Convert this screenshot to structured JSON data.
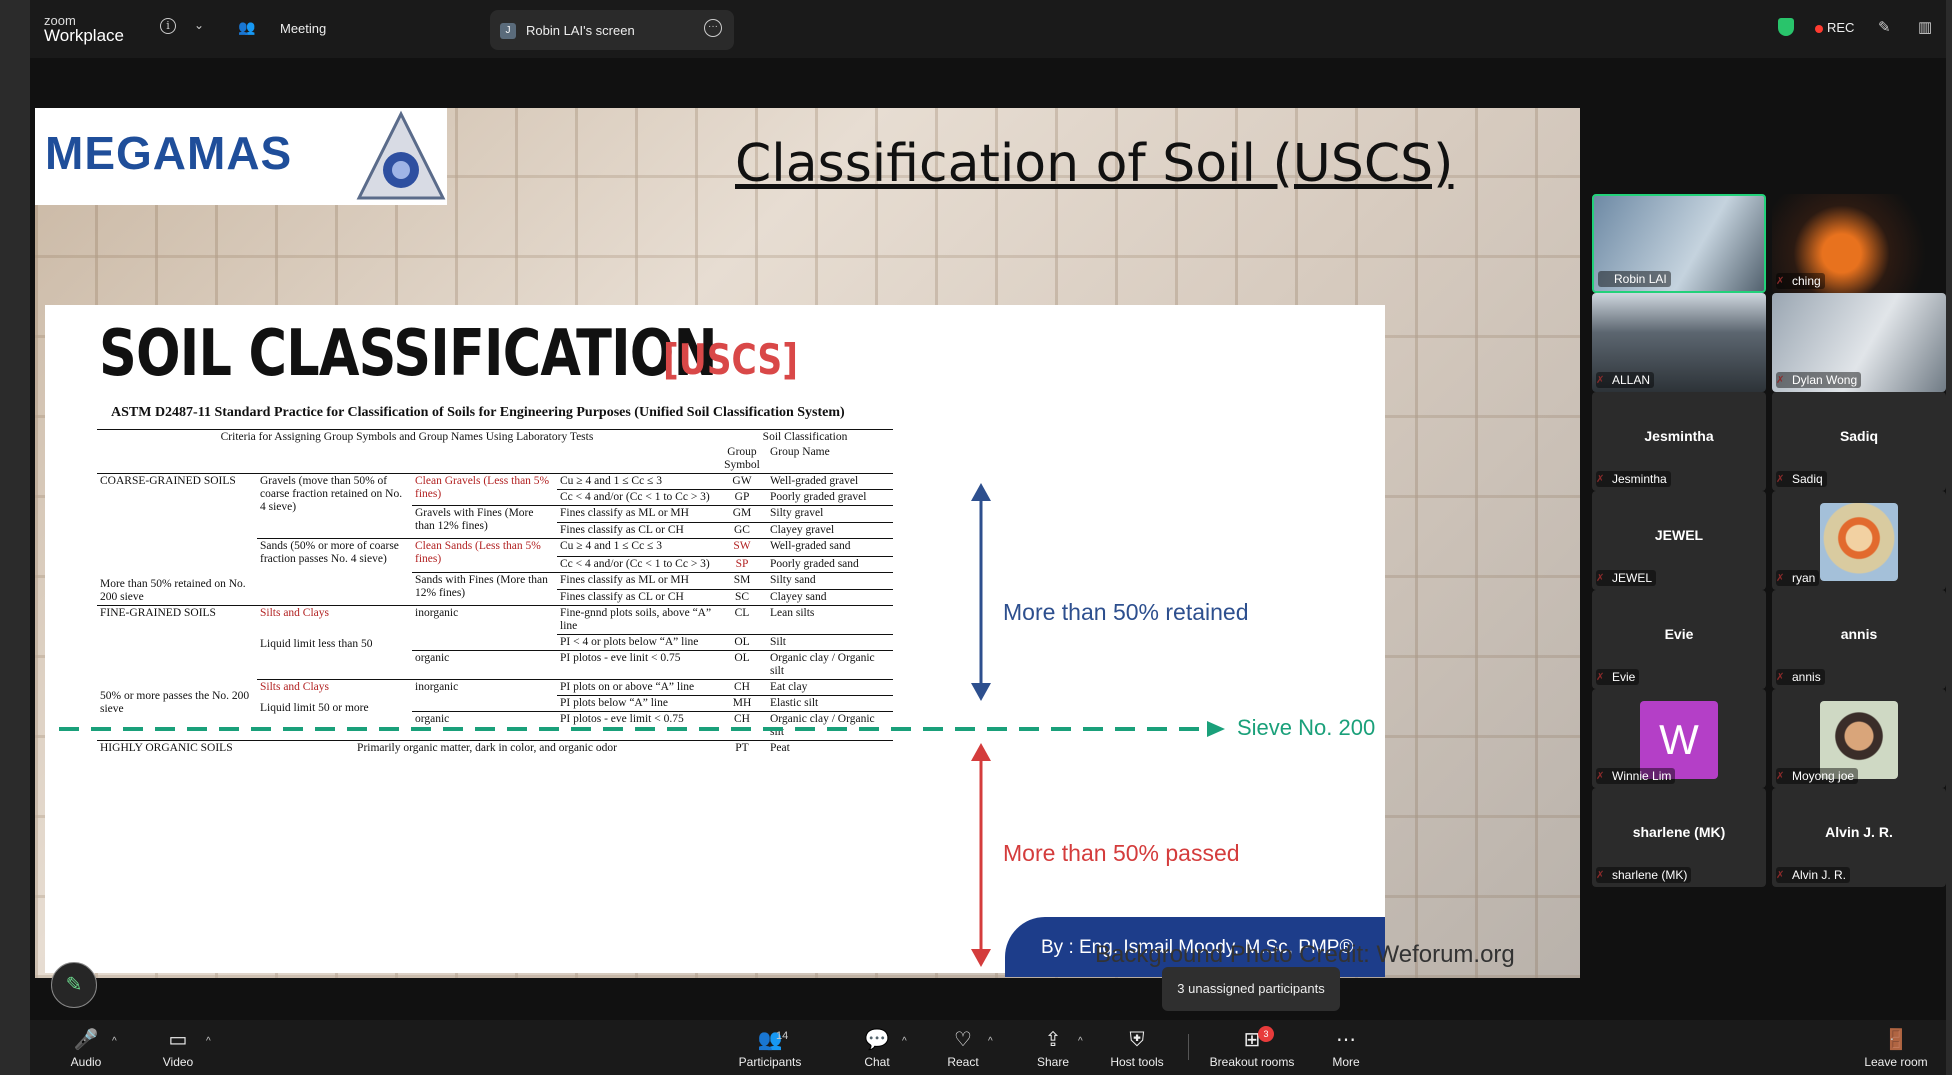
{
  "app": {
    "logo_line1": "zoom",
    "logo_line2": "Workplace",
    "meeting_label": "Meeting",
    "screen_share_label": "Robin LAI's screen",
    "screen_share_avatar": "J",
    "rec_label": "REC",
    "icons": [
      "info-icon",
      "chevron-down-icon",
      "people-icon",
      "more-options-icon",
      "shield-icon",
      "pen-icon",
      "layout-icon"
    ]
  },
  "slide": {
    "logo_text": "MEGAMAS",
    "title": "Classification of Soil (USCS)",
    "heading": "SOIL CLASSIFICATION",
    "heading_tag": "[USCS]",
    "astm_title": "ASTM D2487-11 Standard Practice for Classification of Soils for Engineering Purposes (Unified Soil Classification System)",
    "table": {
      "criteria_header": "Criteria for Assigning Group Symbols and Group Names Using Laboratory Tests",
      "soil_classification": "Soil Classification",
      "group_symbol": "Group Symbol",
      "group_name": "Group Name",
      "coarse_grained": "COARSE-GRAINED SOILS",
      "coarse_retained": "More than 50% retained on No. 200 sieve",
      "gravels": "Gravels (move than 50% of coarse fraction retained on No. 4 sieve)",
      "clean_gravels": "Clean Gravels (Less than 5% fines)",
      "gravels_fines": "Gravels with Fines (More than 12% fines)",
      "sands": "Sands (50% or more of coarse fraction passes No. 4 sieve)",
      "clean_sands": "Clean Sands (Less than 5% fines)",
      "sands_fines": "Sands with Fines (More than 12% fines)",
      "fine_grained": "FINE-GRAINED SOILS",
      "fine_passes": "50% or more passes the No. 200 sieve",
      "silts_clays": "Silts and Clays",
      "ll_less_50": "Liquid limit less than 50",
      "ll_50_more": "Liquid limit 50 or more",
      "inorganic": "inorganic",
      "organic": "organic",
      "highly_organic": "HIGHLY ORGANIC SOILS",
      "highly_organic_desc": "Primarily organic matter, dark in color, and organic odor",
      "rows": [
        {
          "crit": "Cu ≥ 4 and 1 ≤ Cc ≤ 3",
          "sym": "GW",
          "name": "Well-graded gravel"
        },
        {
          "crit": "Cc < 4 and/or (Cc < 1 to Cc > 3)",
          "sym": "GP",
          "name": "Poorly graded gravel"
        },
        {
          "crit": "Fines classify as ML or MH",
          "sym": "GM",
          "name": "Silty gravel"
        },
        {
          "crit": "Fines classify as CL or CH",
          "sym": "GC",
          "name": "Clayey gravel"
        },
        {
          "crit": "Cu ≥ 4 and 1 ≤ Cc ≤ 3",
          "sym": "SW",
          "name": "Well-graded sand"
        },
        {
          "crit": "Cc < 4 and/or (Cc < 1 to Cc > 3)",
          "sym": "SP",
          "name": "Poorly graded sand"
        },
        {
          "crit": "Fines classify as ML or MH",
          "sym": "SM",
          "name": "Silty sand"
        },
        {
          "crit": "Fines classify as CL or CH",
          "sym": "SC",
          "name": "Clayey sand"
        },
        {
          "crit": "Fine-gnnd plots soils, above “A” line",
          "sym": "CL",
          "name": "Lean silts"
        },
        {
          "crit": "PI < 4 or plots below “A” line",
          "sym": "OL",
          "name": "Silt"
        },
        {
          "crit": "PI plotos - eve linit < 0.75",
          "sym": "OL",
          "name": "Organic clay / Organic silt"
        },
        {
          "crit": "PI plots on or above “A” line",
          "sym": "CH",
          "name": "Eat clay"
        },
        {
          "crit": "PI plots below “A” line",
          "sym": "MH",
          "name": "Elastic silt"
        },
        {
          "crit": "PI plotos - eve limit < 0.75",
          "sym": "CH",
          "name": "Organic clay / Organic silt"
        },
        {
          "crit": "",
          "sym": "PT",
          "name": "Peat"
        }
      ]
    },
    "retained_label": "More than 50% retained",
    "sieve_label": "Sieve No. 200",
    "passed_label": "More than 50% passed",
    "byline": "By : Eng. Ismail Moody, M.Sc, PMP®",
    "credit": "Background Photo Credit: Weforum.org",
    "colors": {
      "retained": "#2d4f8e",
      "passed": "#d43c3c",
      "sieve": "#1aa07a"
    }
  },
  "participants": [
    {
      "name": "Robin LAI",
      "kind": "video"
    },
    {
      "name": "ching",
      "kind": "video"
    },
    {
      "name": "ALLAN",
      "kind": "video"
    },
    {
      "name": "Dylan Wong",
      "kind": "video"
    },
    {
      "name": "Jesmintha",
      "kind": "name"
    },
    {
      "name": "Sadiq",
      "kind": "name"
    },
    {
      "name": "JEWEL",
      "kind": "name"
    },
    {
      "name": "ryan",
      "kind": "avatar"
    },
    {
      "name": "Evie",
      "kind": "name"
    },
    {
      "name": "annis",
      "kind": "name"
    },
    {
      "name": "Winnie Lim",
      "kind": "letter",
      "letter": "W"
    },
    {
      "name": "Moyong joe",
      "kind": "avatar"
    },
    {
      "name": "sharlene (MK)",
      "kind": "name"
    },
    {
      "name": "Alvin J. R.",
      "kind": "name"
    }
  ],
  "toolbar": {
    "audio": "Audio",
    "video": "Video",
    "participants": "Participants",
    "participants_count": "14",
    "chat": "Chat",
    "react": "React",
    "share": "Share",
    "host_tools": "Host tools",
    "breakout_rooms": "Breakout rooms",
    "breakout_badge": "3",
    "more": "More",
    "leave_room": "Leave room",
    "tooltip": "3 unassigned participants"
  }
}
